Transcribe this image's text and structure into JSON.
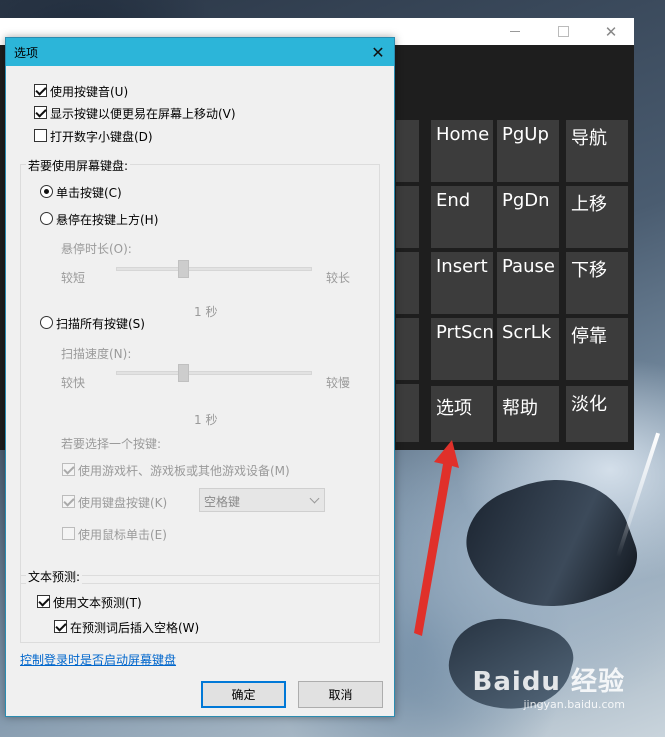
{
  "osk": {
    "keys": [
      {
        "id": "home",
        "label": "Home"
      },
      {
        "id": "pgup",
        "label": "PgUp"
      },
      {
        "id": "nav",
        "label": "导航"
      },
      {
        "id": "end",
        "label": "End"
      },
      {
        "id": "pgdn",
        "label": "PgDn"
      },
      {
        "id": "moveup",
        "label": "上移"
      },
      {
        "id": "insert",
        "label": "Insert"
      },
      {
        "id": "pause",
        "label": "Pause"
      },
      {
        "id": "movedown",
        "label": "下移"
      },
      {
        "id": "prtscn",
        "label": "PrtScn"
      },
      {
        "id": "scrlk",
        "label": "ScrLk"
      },
      {
        "id": "dock",
        "label": "停靠"
      },
      {
        "id": "options",
        "label": "选项"
      },
      {
        "id": "help",
        "label": "帮助"
      },
      {
        "id": "fade",
        "label": "淡化"
      }
    ]
  },
  "dialog": {
    "title": "选项",
    "use_click_sound": "使用按键音(U)",
    "show_keys_move": "显示按键以便更易在屏幕上移动(V)",
    "numeric_keypad": "打开数字小键盘(D)",
    "group_title": "若要使用屏幕键盘:",
    "click_keys": "单击按键(C)",
    "hover_keys": "悬停在按键上方(H)",
    "hover_duration": "悬停时长(O):",
    "shorter": "较短",
    "longer": "较长",
    "hover_value": "1 秒",
    "scan_keys": "扫描所有按键(S)",
    "scan_speed": "扫描速度(N):",
    "faster": "较快",
    "slower": "较慢",
    "scan_value": "1 秒",
    "select_key_label": "若要选择一个按键:",
    "use_joystick": "使用游戏杆、游戏板或其他游戏设备(M)",
    "use_keyboard_key": "使用键盘按键(K)",
    "keyboard_key_value": "空格键",
    "use_mouse_click": "使用鼠标单击(E)",
    "text_prediction_group": "文本预测:",
    "use_text_prediction": "使用文本预测(T)",
    "insert_space": "在预测词后插入空格(W)",
    "startup_link": "控制登录时是否启动屏幕键盘",
    "ok": "确定",
    "cancel": "取消"
  },
  "watermark": {
    "logo": "Baidu 经验",
    "url": "jingyan.baidu.com"
  },
  "colors": {
    "dialog_title": "#2cb5d9",
    "osk_key": "#3c3c3c",
    "arrow": "#e0302a",
    "link": "#0066cc"
  }
}
